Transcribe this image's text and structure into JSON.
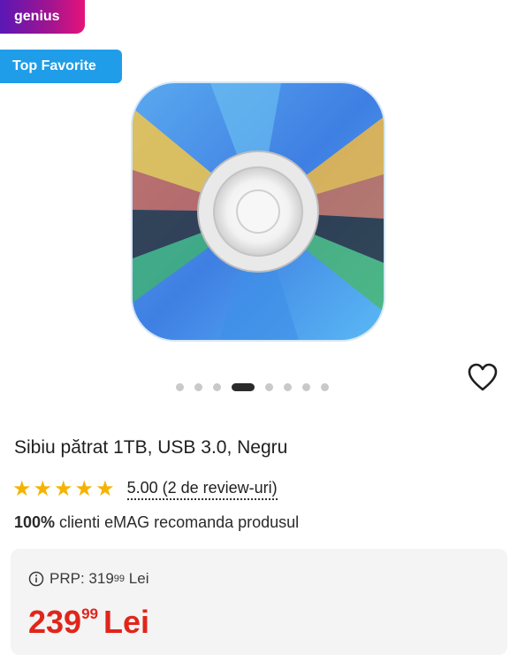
{
  "badges": {
    "genius": "genius",
    "top_favorite": "Top Favorite"
  },
  "product": {
    "image_icon": "disc-image",
    "title": "Sibiu pătrat 1TB, USB 3.0, Negru",
    "rating_value": "5.00 (2 de review-uri)",
    "stars": 5,
    "recommend_bold": "100%",
    "recommend_text": " clienti eMAG recomanda produsul"
  },
  "carousel": {
    "dot_count": 8,
    "active_index": 3
  },
  "price": {
    "prp_label": "PRP:",
    "prp_int": "319",
    "prp_dec": "99",
    "prp_currency": "Lei",
    "int": "239",
    "dec": "99",
    "currency": "Lei"
  },
  "colors": {
    "accent_blue": "#1f9de8",
    "price_red": "#e1251b",
    "star_yellow": "#f5b301"
  }
}
